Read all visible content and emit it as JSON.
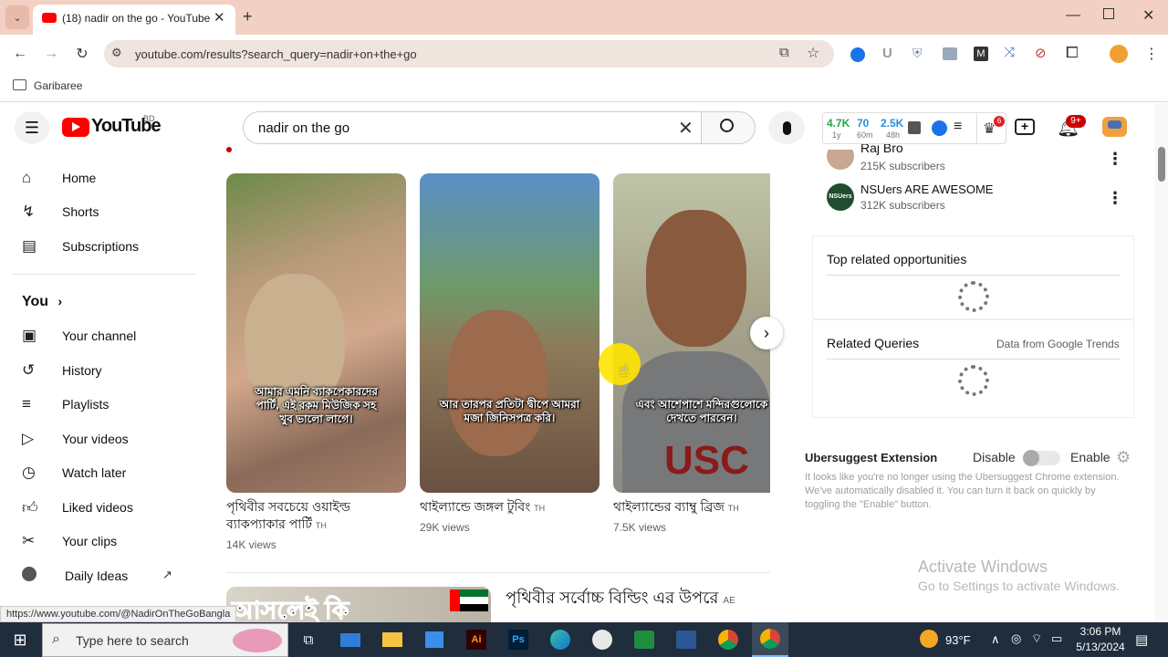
{
  "browser": {
    "tab_title": "(18) nadir on the go - YouTube",
    "url": "youtube.com/results?search_query=nadir+on+the+go",
    "bookmark": "Garibaree",
    "status_url": "https://www.youtube.com/@NadirOnTheGoBangla"
  },
  "header": {
    "logo_text": "YouTube",
    "country": "BD",
    "search_value": "nadir on the go",
    "stat1": "4.7K",
    "stat1_sub": "1y",
    "stat2": "70",
    "stat2_sub": "60m",
    "stat3": "2.5K",
    "stat3_sub": "48h",
    "trophy_badge": "6",
    "bell_badge": "9+"
  },
  "sidebar": {
    "items": [
      {
        "label": "Home"
      },
      {
        "label": "Shorts"
      },
      {
        "label": "Subscriptions"
      }
    ],
    "you_label": "You",
    "you_items": [
      {
        "label": "Your channel"
      },
      {
        "label": "History"
      },
      {
        "label": "Playlists"
      },
      {
        "label": "Your videos"
      },
      {
        "label": "Watch later"
      },
      {
        "label": "Liked videos"
      },
      {
        "label": "Your clips"
      },
      {
        "label": "Daily Ideas"
      }
    ]
  },
  "shorts": [
    {
      "subtitle": "আমার এমনি ব্যাকপেকারদের পার্টি, এই রকম মিউজিক সহ খুব ভালো লাগে।",
      "title": "পৃথিবীর সবচেয়ে ওয়াইল্ড ব্যাকপ্যাকার পার্টি",
      "tag": "TH",
      "views": "14K views"
    },
    {
      "subtitle": "আর তারপর প্রতিটা দ্বীপে আমরা মজা জিনিসপত্র করি।",
      "title": "থাইল্যান্ডে জঙ্গল টুবিং",
      "tag": "TH",
      "views": "29K views"
    },
    {
      "subtitle": "এবং আশেপাশে মন্দিরগুলোকে দেখতে পারবেন।",
      "title": "থাইল্যান্ডের ব্যাম্বু ব্রিজ",
      "tag": "TH",
      "views": "7.5K views"
    }
  ],
  "next_video": {
    "thumb_text": "আসলেই কি",
    "title": "পৃথিবীর সর্বোচ্চ বিল্ডিং এর উপরে",
    "tag": "AE"
  },
  "right_panel": {
    "channels": [
      {
        "name": "Raj Bro",
        "subs": "215K subscribers"
      },
      {
        "name": "NSUers ARE AWESOME",
        "subs": "312K subscribers",
        "avatar_text": "NSUers"
      }
    ],
    "top_related": "Top related opportunities",
    "related_queries": "Related Queries",
    "google_trends": "Data from Google Trends",
    "ext_title": "Ubersuggest Extension",
    "disable": "Disable",
    "enable": "Enable",
    "ext_msg": "It looks like you're no longer using the Ubersuggest Chrome extension. We've automatically disabled it. You can turn it back on quickly by toggling the \"Enable\" button."
  },
  "watermark": {
    "line1": "Activate Windows",
    "line2": "Go to Settings to activate Windows."
  },
  "taskbar": {
    "search_placeholder": "Type here to search",
    "temp": "93°F",
    "time": "3:06 PM",
    "date": "5/13/2024"
  }
}
